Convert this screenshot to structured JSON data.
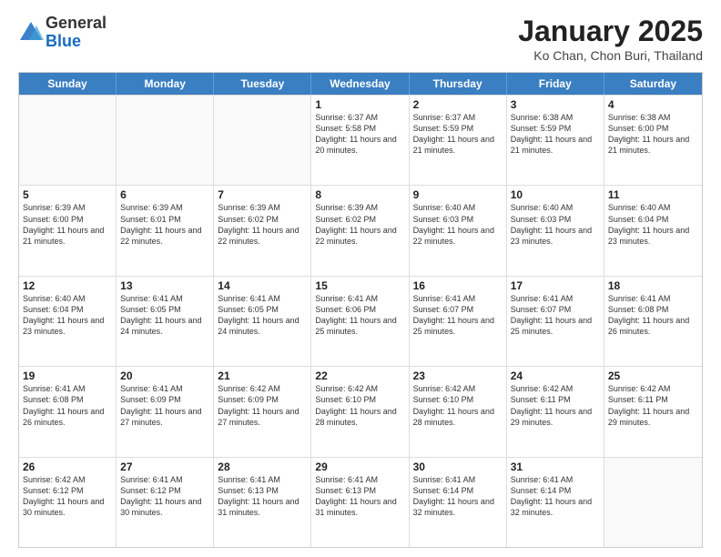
{
  "header": {
    "logo_general": "General",
    "logo_blue": "Blue",
    "title": "January 2025",
    "subtitle": "Ko Chan, Chon Buri, Thailand"
  },
  "days_of_week": [
    "Sunday",
    "Monday",
    "Tuesday",
    "Wednesday",
    "Thursday",
    "Friday",
    "Saturday"
  ],
  "weeks": [
    [
      {
        "day": "",
        "info": ""
      },
      {
        "day": "",
        "info": ""
      },
      {
        "day": "",
        "info": ""
      },
      {
        "day": "1",
        "info": "Sunrise: 6:37 AM\nSunset: 5:58 PM\nDaylight: 11 hours and 20 minutes."
      },
      {
        "day": "2",
        "info": "Sunrise: 6:37 AM\nSunset: 5:59 PM\nDaylight: 11 hours and 21 minutes."
      },
      {
        "day": "3",
        "info": "Sunrise: 6:38 AM\nSunset: 5:59 PM\nDaylight: 11 hours and 21 minutes."
      },
      {
        "day": "4",
        "info": "Sunrise: 6:38 AM\nSunset: 6:00 PM\nDaylight: 11 hours and 21 minutes."
      }
    ],
    [
      {
        "day": "5",
        "info": "Sunrise: 6:39 AM\nSunset: 6:00 PM\nDaylight: 11 hours and 21 minutes."
      },
      {
        "day": "6",
        "info": "Sunrise: 6:39 AM\nSunset: 6:01 PM\nDaylight: 11 hours and 22 minutes."
      },
      {
        "day": "7",
        "info": "Sunrise: 6:39 AM\nSunset: 6:02 PM\nDaylight: 11 hours and 22 minutes."
      },
      {
        "day": "8",
        "info": "Sunrise: 6:39 AM\nSunset: 6:02 PM\nDaylight: 11 hours and 22 minutes."
      },
      {
        "day": "9",
        "info": "Sunrise: 6:40 AM\nSunset: 6:03 PM\nDaylight: 11 hours and 22 minutes."
      },
      {
        "day": "10",
        "info": "Sunrise: 6:40 AM\nSunset: 6:03 PM\nDaylight: 11 hours and 23 minutes."
      },
      {
        "day": "11",
        "info": "Sunrise: 6:40 AM\nSunset: 6:04 PM\nDaylight: 11 hours and 23 minutes."
      }
    ],
    [
      {
        "day": "12",
        "info": "Sunrise: 6:40 AM\nSunset: 6:04 PM\nDaylight: 11 hours and 23 minutes."
      },
      {
        "day": "13",
        "info": "Sunrise: 6:41 AM\nSunset: 6:05 PM\nDaylight: 11 hours and 24 minutes."
      },
      {
        "day": "14",
        "info": "Sunrise: 6:41 AM\nSunset: 6:05 PM\nDaylight: 11 hours and 24 minutes."
      },
      {
        "day": "15",
        "info": "Sunrise: 6:41 AM\nSunset: 6:06 PM\nDaylight: 11 hours and 25 minutes."
      },
      {
        "day": "16",
        "info": "Sunrise: 6:41 AM\nSunset: 6:07 PM\nDaylight: 11 hours and 25 minutes."
      },
      {
        "day": "17",
        "info": "Sunrise: 6:41 AM\nSunset: 6:07 PM\nDaylight: 11 hours and 25 minutes."
      },
      {
        "day": "18",
        "info": "Sunrise: 6:41 AM\nSunset: 6:08 PM\nDaylight: 11 hours and 26 minutes."
      }
    ],
    [
      {
        "day": "19",
        "info": "Sunrise: 6:41 AM\nSunset: 6:08 PM\nDaylight: 11 hours and 26 minutes."
      },
      {
        "day": "20",
        "info": "Sunrise: 6:41 AM\nSunset: 6:09 PM\nDaylight: 11 hours and 27 minutes."
      },
      {
        "day": "21",
        "info": "Sunrise: 6:42 AM\nSunset: 6:09 PM\nDaylight: 11 hours and 27 minutes."
      },
      {
        "day": "22",
        "info": "Sunrise: 6:42 AM\nSunset: 6:10 PM\nDaylight: 11 hours and 28 minutes."
      },
      {
        "day": "23",
        "info": "Sunrise: 6:42 AM\nSunset: 6:10 PM\nDaylight: 11 hours and 28 minutes."
      },
      {
        "day": "24",
        "info": "Sunrise: 6:42 AM\nSunset: 6:11 PM\nDaylight: 11 hours and 29 minutes."
      },
      {
        "day": "25",
        "info": "Sunrise: 6:42 AM\nSunset: 6:11 PM\nDaylight: 11 hours and 29 minutes."
      }
    ],
    [
      {
        "day": "26",
        "info": "Sunrise: 6:42 AM\nSunset: 6:12 PM\nDaylight: 11 hours and 30 minutes."
      },
      {
        "day": "27",
        "info": "Sunrise: 6:41 AM\nSunset: 6:12 PM\nDaylight: 11 hours and 30 minutes."
      },
      {
        "day": "28",
        "info": "Sunrise: 6:41 AM\nSunset: 6:13 PM\nDaylight: 11 hours and 31 minutes."
      },
      {
        "day": "29",
        "info": "Sunrise: 6:41 AM\nSunset: 6:13 PM\nDaylight: 11 hours and 31 minutes."
      },
      {
        "day": "30",
        "info": "Sunrise: 6:41 AM\nSunset: 6:14 PM\nDaylight: 11 hours and 32 minutes."
      },
      {
        "day": "31",
        "info": "Sunrise: 6:41 AM\nSunset: 6:14 PM\nDaylight: 11 hours and 32 minutes."
      },
      {
        "day": "",
        "info": ""
      }
    ]
  ]
}
